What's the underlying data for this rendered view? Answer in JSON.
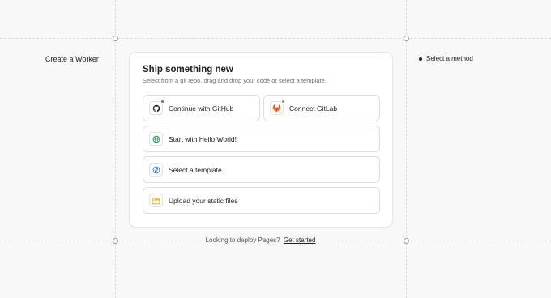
{
  "page": {
    "left_label": "Create a Worker",
    "step_label": "Select a method"
  },
  "card": {
    "title": "Ship something new",
    "subtitle": "Select from a git repo, drag and drop your code or select a template.",
    "options": [
      {
        "label": "Continue with GitHub",
        "icon": "github-icon",
        "badge_color": "#1fa34a"
      },
      {
        "label": "Connect GitLab",
        "icon": "gitlab-icon",
        "badge_color": "#8a8a8a"
      },
      {
        "label": "Start with Hello World!",
        "icon": "globe-icon",
        "color": "#1f9d55"
      },
      {
        "label": "Select a template",
        "icon": "compass-icon",
        "color": "#2f6fed"
      },
      {
        "label": "Upload your static files",
        "icon": "folder-icon",
        "color": "#e3a008"
      }
    ]
  },
  "footer": {
    "text": "Looking to deploy Pages?",
    "link": "Get started"
  },
  "colors": {
    "gitlab_orange": "#e8743b",
    "background": "#f8f8f8",
    "card_border": "#e6e6e6"
  }
}
